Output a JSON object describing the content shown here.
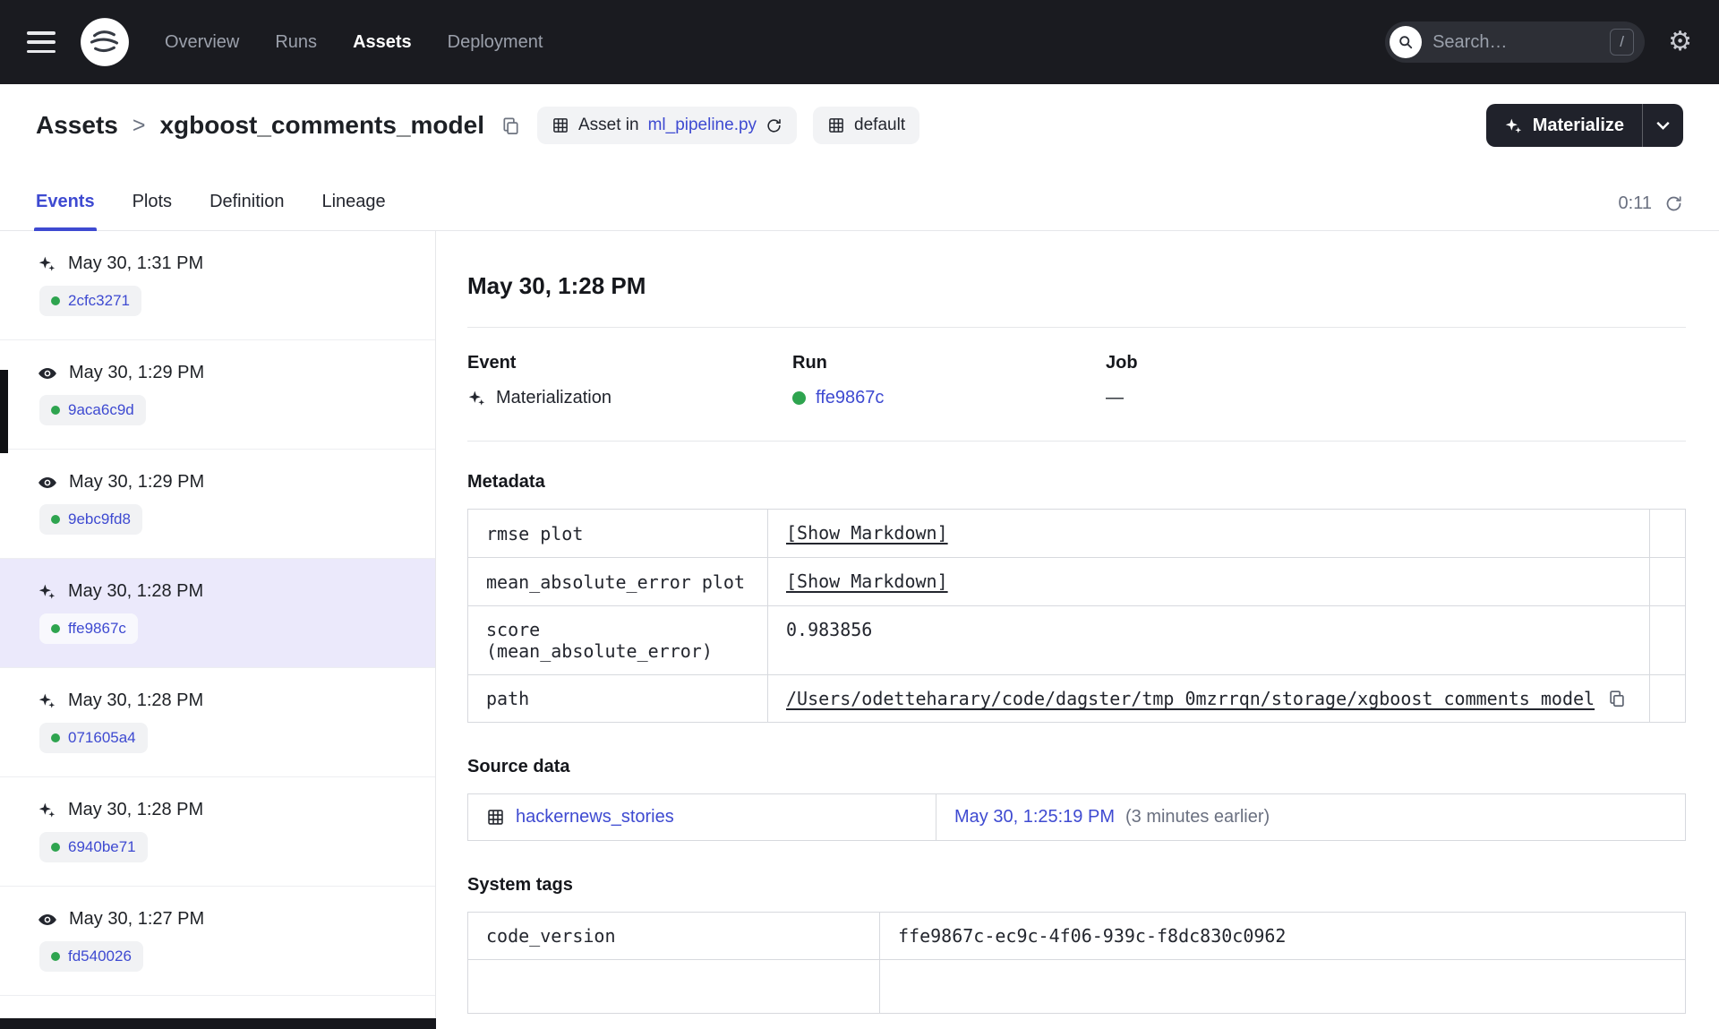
{
  "colors": {
    "accent": "#3E4AD1",
    "success_green": "#2EA44F",
    "nav_bg": "#1A1B20",
    "selected_bg": "#EBE9FB"
  },
  "topnav": {
    "nav_items": [
      {
        "label": "Overview"
      },
      {
        "label": "Runs"
      },
      {
        "label": "Assets",
        "active": true
      },
      {
        "label": "Deployment"
      }
    ],
    "search": {
      "placeholder": "Search…",
      "shortcut": "/"
    }
  },
  "header": {
    "breadcrumb": {
      "root": "Assets",
      "separator": ">",
      "current": "xgboost_comments_model"
    },
    "asset_badge": {
      "prefix": "Asset in",
      "file": "ml_pipeline.py"
    },
    "group_badge": {
      "label": "default"
    },
    "materialize": {
      "label": "Materialize"
    }
  },
  "tabs": {
    "items": [
      {
        "label": "Events",
        "active": true
      },
      {
        "label": "Plots"
      },
      {
        "label": "Definition"
      },
      {
        "label": "Lineage"
      }
    ],
    "timer": "0:11"
  },
  "sidebar": {
    "events": [
      {
        "type": "materialization",
        "time": "May 30, 1:31 PM",
        "run": "2cfc3271"
      },
      {
        "type": "observation",
        "time": "May 30, 1:29 PM",
        "run": "9aca6c9d"
      },
      {
        "type": "observation",
        "time": "May 30, 1:29 PM",
        "run": "9ebc9fd8"
      },
      {
        "type": "materialization",
        "time": "May 30, 1:28 PM",
        "run": "ffe9867c",
        "selected": true
      },
      {
        "type": "materialization",
        "time": "May 30, 1:28 PM",
        "run": "071605a4"
      },
      {
        "type": "materialization",
        "time": "May 30, 1:28 PM",
        "run": "6940be71"
      },
      {
        "type": "observation",
        "time": "May 30, 1:27 PM",
        "run": "fd540026"
      }
    ]
  },
  "detail": {
    "title": "May 30, 1:28 PM",
    "event": {
      "label": "Event",
      "value": "Materialization"
    },
    "run": {
      "label": "Run",
      "value": "ffe9867c"
    },
    "job": {
      "label": "Job",
      "value": "—"
    },
    "metadata": {
      "heading": "Metadata",
      "rows": [
        {
          "key": "rmse plot",
          "value": "[Show Markdown]"
        },
        {
          "key": "mean_absolute_error plot",
          "value": "[Show Markdown]"
        },
        {
          "key1": "score",
          "key2": "(mean_absolute_error)",
          "value": "0.983856"
        },
        {
          "key": "path",
          "value": "/Users/odetteharary/code/dagster/tmp_0mzrrqn/storage/xgboost_comments_model"
        }
      ]
    },
    "source_data": {
      "heading": "Source data",
      "asset": "hackernews_stories",
      "time": "May 30, 1:25:19 PM",
      "relative": "(3 minutes earlier)"
    },
    "system_tags": {
      "heading": "System tags",
      "rows": [
        {
          "key": "code_version",
          "value": "ffe9867c-ec9c-4f06-939c-f8dc830c0962"
        }
      ]
    }
  }
}
